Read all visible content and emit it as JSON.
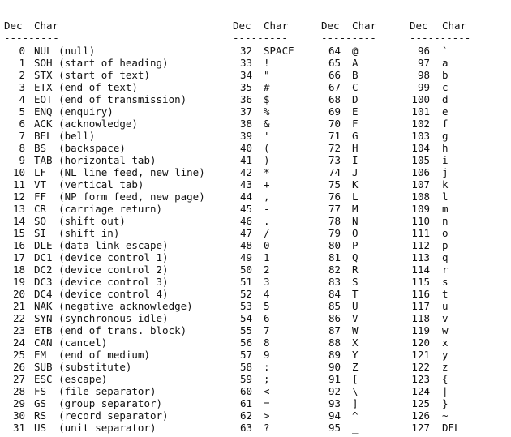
{
  "headers": {
    "dec": "Dec",
    "char": "Char",
    "rule_narrow": "---------",
    "rule_wide": "----------"
  },
  "columns": [
    {
      "rows": [
        {
          "dec": "0",
          "char": "NUL (null)"
        },
        {
          "dec": "1",
          "char": "SOH (start of heading)"
        },
        {
          "dec": "2",
          "char": "STX (start of text)"
        },
        {
          "dec": "3",
          "char": "ETX (end of text)"
        },
        {
          "dec": "4",
          "char": "EOT (end of transmission)"
        },
        {
          "dec": "5",
          "char": "ENQ (enquiry)"
        },
        {
          "dec": "6",
          "char": "ACK (acknowledge)"
        },
        {
          "dec": "7",
          "char": "BEL (bell)"
        },
        {
          "dec": "8",
          "char": "BS  (backspace)"
        },
        {
          "dec": "9",
          "char": "TAB (horizontal tab)"
        },
        {
          "dec": "10",
          "char": "LF  (NL line feed, new line)"
        },
        {
          "dec": "11",
          "char": "VT  (vertical tab)"
        },
        {
          "dec": "12",
          "char": "FF  (NP form feed, new page)"
        },
        {
          "dec": "13",
          "char": "CR  (carriage return)"
        },
        {
          "dec": "14",
          "char": "SO  (shift out)"
        },
        {
          "dec": "15",
          "char": "SI  (shift in)"
        },
        {
          "dec": "16",
          "char": "DLE (data link escape)"
        },
        {
          "dec": "17",
          "char": "DC1 (device control 1)"
        },
        {
          "dec": "18",
          "char": "DC2 (device control 2)"
        },
        {
          "dec": "19",
          "char": "DC3 (device control 3)"
        },
        {
          "dec": "20",
          "char": "DC4 (device control 4)"
        },
        {
          "dec": "21",
          "char": "NAK (negative acknowledge)"
        },
        {
          "dec": "22",
          "char": "SYN (synchronous idle)"
        },
        {
          "dec": "23",
          "char": "ETB (end of trans. block)"
        },
        {
          "dec": "24",
          "char": "CAN (cancel)"
        },
        {
          "dec": "25",
          "char": "EM  (end of medium)"
        },
        {
          "dec": "26",
          "char": "SUB (substitute)"
        },
        {
          "dec": "27",
          "char": "ESC (escape)"
        },
        {
          "dec": "28",
          "char": "FS  (file separator)"
        },
        {
          "dec": "29",
          "char": "GS  (group separator)"
        },
        {
          "dec": "30",
          "char": "RS  (record separator)"
        },
        {
          "dec": "31",
          "char": "US  (unit separator)"
        }
      ]
    },
    {
      "rows": [
        {
          "dec": "32",
          "char": "SPACE"
        },
        {
          "dec": "33",
          "char": "!"
        },
        {
          "dec": "34",
          "char": "\""
        },
        {
          "dec": "35",
          "char": "#"
        },
        {
          "dec": "36",
          "char": "$"
        },
        {
          "dec": "37",
          "char": "%"
        },
        {
          "dec": "38",
          "char": "&"
        },
        {
          "dec": "39",
          "char": "'"
        },
        {
          "dec": "40",
          "char": "("
        },
        {
          "dec": "41",
          "char": ")"
        },
        {
          "dec": "42",
          "char": "*"
        },
        {
          "dec": "43",
          "char": "+"
        },
        {
          "dec": "44",
          "char": ","
        },
        {
          "dec": "45",
          "char": "-"
        },
        {
          "dec": "46",
          "char": "."
        },
        {
          "dec": "47",
          "char": "/"
        },
        {
          "dec": "48",
          "char": "0"
        },
        {
          "dec": "49",
          "char": "1"
        },
        {
          "dec": "50",
          "char": "2"
        },
        {
          "dec": "51",
          "char": "3"
        },
        {
          "dec": "52",
          "char": "4"
        },
        {
          "dec": "53",
          "char": "5"
        },
        {
          "dec": "54",
          "char": "6"
        },
        {
          "dec": "55",
          "char": "7"
        },
        {
          "dec": "56",
          "char": "8"
        },
        {
          "dec": "57",
          "char": "9"
        },
        {
          "dec": "58",
          "char": ":"
        },
        {
          "dec": "59",
          "char": ";"
        },
        {
          "dec": "60",
          "char": "<"
        },
        {
          "dec": "61",
          "char": "="
        },
        {
          "dec": "62",
          "char": ">"
        },
        {
          "dec": "63",
          "char": "?"
        }
      ]
    },
    {
      "rows": [
        {
          "dec": "64",
          "char": "@"
        },
        {
          "dec": "65",
          "char": "A"
        },
        {
          "dec": "66",
          "char": "B"
        },
        {
          "dec": "67",
          "char": "C"
        },
        {
          "dec": "68",
          "char": "D"
        },
        {
          "dec": "69",
          "char": "E"
        },
        {
          "dec": "70",
          "char": "F"
        },
        {
          "dec": "71",
          "char": "G"
        },
        {
          "dec": "72",
          "char": "H"
        },
        {
          "dec": "73",
          "char": "I"
        },
        {
          "dec": "74",
          "char": "J"
        },
        {
          "dec": "75",
          "char": "K"
        },
        {
          "dec": "76",
          "char": "L"
        },
        {
          "dec": "77",
          "char": "M"
        },
        {
          "dec": "78",
          "char": "N"
        },
        {
          "dec": "79",
          "char": "O"
        },
        {
          "dec": "80",
          "char": "P"
        },
        {
          "dec": "81",
          "char": "Q"
        },
        {
          "dec": "82",
          "char": "R"
        },
        {
          "dec": "83",
          "char": "S"
        },
        {
          "dec": "84",
          "char": "T"
        },
        {
          "dec": "85",
          "char": "U"
        },
        {
          "dec": "86",
          "char": "V"
        },
        {
          "dec": "87",
          "char": "W"
        },
        {
          "dec": "88",
          "char": "X"
        },
        {
          "dec": "89",
          "char": "Y"
        },
        {
          "dec": "90",
          "char": "Z"
        },
        {
          "dec": "91",
          "char": "["
        },
        {
          "dec": "92",
          "char": "\\"
        },
        {
          "dec": "93",
          "char": "]"
        },
        {
          "dec": "94",
          "char": "^"
        },
        {
          "dec": "95",
          "char": "_"
        }
      ]
    },
    {
      "rows": [
        {
          "dec": "96",
          "char": "`"
        },
        {
          "dec": "97",
          "char": "a"
        },
        {
          "dec": "98",
          "char": "b"
        },
        {
          "dec": "99",
          "char": "c"
        },
        {
          "dec": "100",
          "char": "d"
        },
        {
          "dec": "101",
          "char": "e"
        },
        {
          "dec": "102",
          "char": "f"
        },
        {
          "dec": "103",
          "char": "g"
        },
        {
          "dec": "104",
          "char": "h"
        },
        {
          "dec": "105",
          "char": "i"
        },
        {
          "dec": "106",
          "char": "j"
        },
        {
          "dec": "107",
          "char": "k"
        },
        {
          "dec": "108",
          "char": "l"
        },
        {
          "dec": "109",
          "char": "m"
        },
        {
          "dec": "110",
          "char": "n"
        },
        {
          "dec": "111",
          "char": "o"
        },
        {
          "dec": "112",
          "char": "p"
        },
        {
          "dec": "113",
          "char": "q"
        },
        {
          "dec": "114",
          "char": "r"
        },
        {
          "dec": "115",
          "char": "s"
        },
        {
          "dec": "116",
          "char": "t"
        },
        {
          "dec": "117",
          "char": "u"
        },
        {
          "dec": "118",
          "char": "v"
        },
        {
          "dec": "119",
          "char": "w"
        },
        {
          "dec": "120",
          "char": "x"
        },
        {
          "dec": "121",
          "char": "y"
        },
        {
          "dec": "122",
          "char": "z"
        },
        {
          "dec": "123",
          "char": "{"
        },
        {
          "dec": "124",
          "char": "|"
        },
        {
          "dec": "125",
          "char": "}"
        },
        {
          "dec": "126",
          "char": "~"
        },
        {
          "dec": "127",
          "char": "DEL"
        }
      ]
    }
  ]
}
